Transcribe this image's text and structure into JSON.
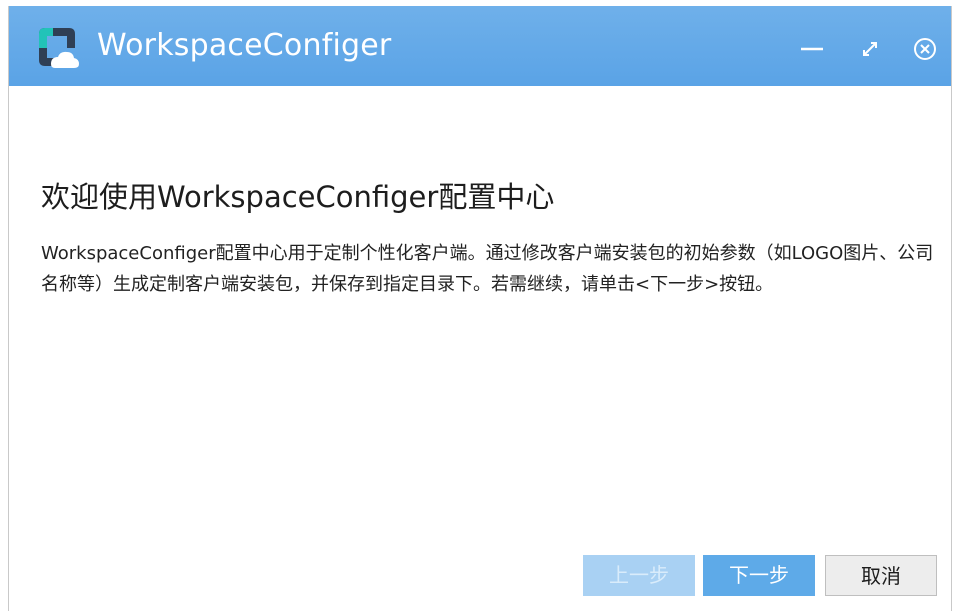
{
  "window": {
    "title": "WorkspaceConfiger"
  },
  "icons": {
    "app_logo": "app-logo-icon",
    "minimize": "minimize-icon",
    "maximize": "maximize-icon",
    "close": "close-circle-icon"
  },
  "content": {
    "heading": "欢迎使用WorkspaceConfiger配置中心",
    "description": "WorkspaceConfiger配置中心用于定制个性化客户端。通过修改客户端安装包的初始参数（如LOGO图片、公司名称等）生成定制客户端安装包，并保存到指定目录下。若需继续，请单击<下一步>按钮。"
  },
  "buttons": {
    "prev_label": "上一步",
    "next_label": "下一步",
    "cancel_label": "取消",
    "prev_enabled": false
  },
  "colors": {
    "titlebar": "#5aa3e6",
    "primary_button": "#5eaae8",
    "disabled_button": "#a9d1f3"
  }
}
